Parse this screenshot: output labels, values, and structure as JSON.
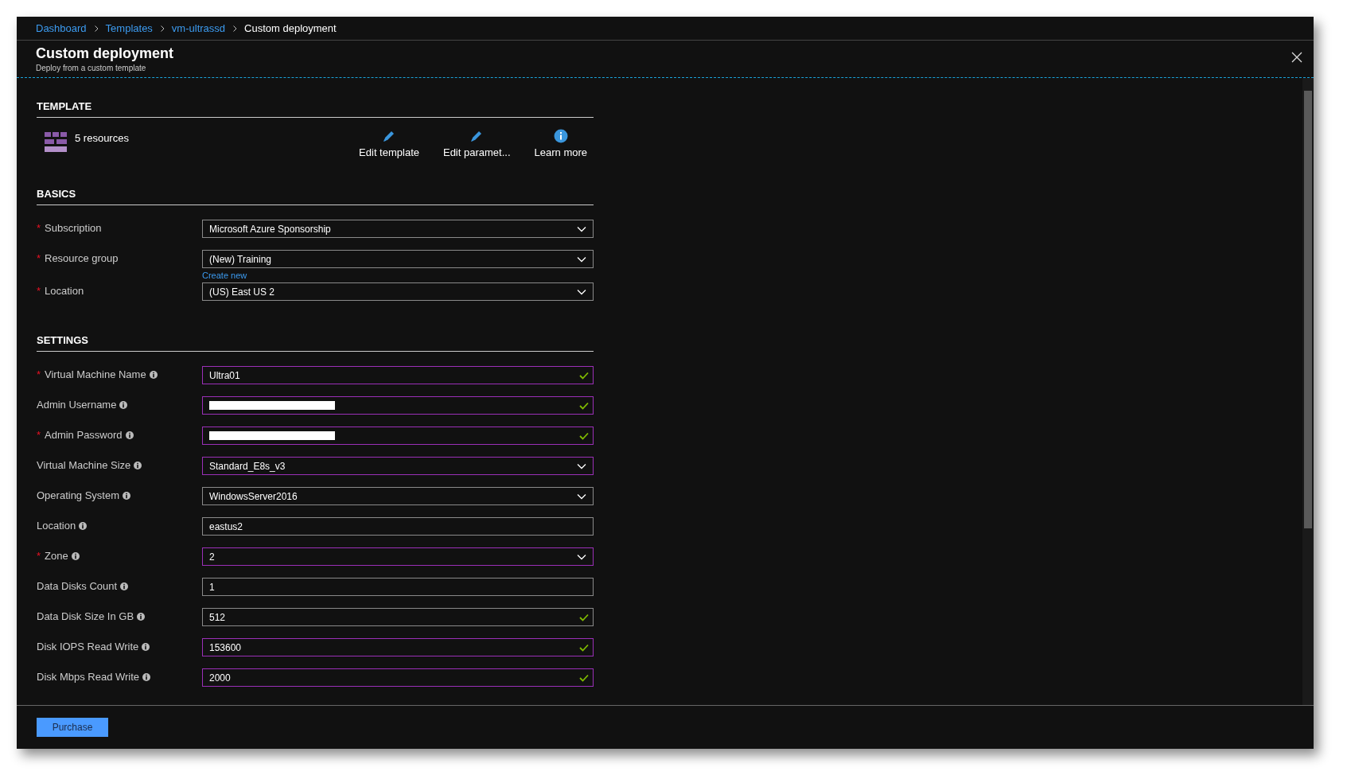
{
  "breadcrumb": [
    {
      "label": "Dashboard",
      "link": true
    },
    {
      "label": "Templates",
      "link": true
    },
    {
      "label": "vm-ultrassd",
      "link": true
    },
    {
      "label": "Custom deployment",
      "link": false
    }
  ],
  "header": {
    "title": "Custom deployment",
    "subtitle": "Deploy from a custom template"
  },
  "template": {
    "heading": "TEMPLATE",
    "resources": "5 resources",
    "actions": [
      {
        "kind": "pencil",
        "label": "Edit template"
      },
      {
        "kind": "pencil",
        "label": "Edit paramet..."
      },
      {
        "kind": "info",
        "label": "Learn more"
      }
    ]
  },
  "basics": {
    "heading": "BASICS",
    "fields": [
      {
        "label": "Subscription",
        "required": "*",
        "info": false,
        "kind": "dropdown",
        "value": "Microsoft Azure Sponsorship",
        "modified": false,
        "valid": false
      },
      {
        "label": "Resource group",
        "required": "*",
        "info": false,
        "kind": "dropdown",
        "value": "(New) Training",
        "modified": false,
        "valid": false,
        "link": "Create new"
      },
      {
        "label": "Location",
        "required": "*",
        "info": false,
        "kind": "dropdown",
        "value": "(US) East US 2",
        "modified": false,
        "valid": false
      }
    ]
  },
  "settings": {
    "heading": "SETTINGS",
    "fields": [
      {
        "label": "Virtual Machine Name",
        "required": "*",
        "info": true,
        "kind": "text",
        "value": "Ultra01",
        "modified": true,
        "valid": true
      },
      {
        "label": "Admin Username",
        "info": true,
        "kind": "redacted",
        "modified": true,
        "valid": true
      },
      {
        "label": "Admin Password",
        "required": "*",
        "info": true,
        "kind": "redacted",
        "modified": true,
        "valid": true
      },
      {
        "label": "Virtual Machine Size",
        "info": true,
        "kind": "dropdown",
        "value": "Standard_E8s_v3",
        "modified": true,
        "valid": false
      },
      {
        "label": "Operating System",
        "info": true,
        "kind": "dropdown",
        "value": "WindowsServer2016",
        "modified": false,
        "valid": false
      },
      {
        "label": "Location",
        "info": true,
        "kind": "text",
        "value": "eastus2",
        "modified": false,
        "valid": false
      },
      {
        "label": "Zone",
        "required": "*",
        "info": true,
        "kind": "dropdown",
        "value": "2",
        "modified": true,
        "valid": false
      },
      {
        "label": "Data Disks Count",
        "info": true,
        "kind": "text",
        "value": "1",
        "modified": false,
        "valid": false
      },
      {
        "label": "Data Disk Size In GB",
        "info": true,
        "kind": "text",
        "value": "512",
        "modified": false,
        "valid": true
      },
      {
        "label": "Disk IOPS Read Write",
        "info": true,
        "kind": "text",
        "value": "153600",
        "modified": true,
        "valid": true
      },
      {
        "label": "Disk Mbps Read Write",
        "info": true,
        "kind": "text",
        "value": "2000",
        "modified": true,
        "valid": true
      }
    ]
  },
  "footer": {
    "button": "Purchase"
  }
}
